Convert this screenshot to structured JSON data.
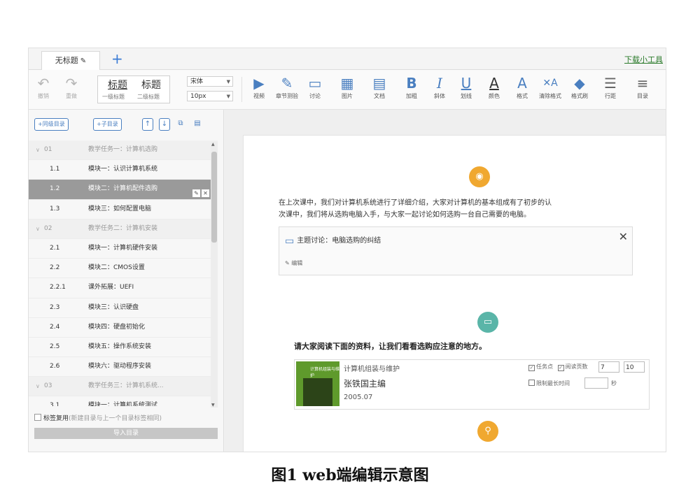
{
  "tabbar": {
    "doc_tab": "无标题",
    "doc_tab_icon": "pencil-icon",
    "add_tab": "+",
    "download_link": "下载小工具"
  },
  "toolbar": {
    "undo": "撤销",
    "redo": "重做",
    "style_title_1": "标题",
    "style_title_2": "标题",
    "style_sub_1": "一级标题",
    "style_sub_2": "二级标题",
    "font_family": "宋体",
    "font_size": "10px",
    "buttons": [
      {
        "label": "视频",
        "icon": "video-icon"
      },
      {
        "label": "章节测验",
        "icon": "quiz-icon"
      },
      {
        "label": "讨论",
        "icon": "discussion-icon"
      },
      {
        "label": "图片",
        "icon": "image-icon"
      },
      {
        "label": "文档",
        "icon": "document-icon"
      },
      {
        "label": "加粗",
        "icon": "bold-icon"
      },
      {
        "label": "斜体",
        "icon": "italic-icon"
      },
      {
        "label": "划线",
        "icon": "underline-icon"
      },
      {
        "label": "颜色",
        "icon": "font-color-icon"
      },
      {
        "label": "格式",
        "icon": "format-icon"
      },
      {
        "label": "清除格式",
        "icon": "clear-format-icon"
      },
      {
        "label": "格式刷",
        "icon": "format-brush-icon"
      },
      {
        "label": "行距",
        "icon": "line-height-icon"
      },
      {
        "label": "目录",
        "icon": "toc-icon"
      }
    ]
  },
  "sidebar": {
    "add_sibling": "+同级目录",
    "add_child": "+子目录",
    "outline": [
      {
        "num": "01",
        "title": "教学任务一：计算机选购",
        "type": "group"
      },
      {
        "num": "1.1",
        "title": "模块一：认识计算机系统",
        "type": "item"
      },
      {
        "num": "1.2",
        "title": "模块二：计算机配件选购",
        "type": "selected"
      },
      {
        "num": "1.3",
        "title": "模块三：如何配置电脑",
        "type": "item"
      },
      {
        "num": "02",
        "title": "教学任务二：计算机安装",
        "type": "group"
      },
      {
        "num": "2.1",
        "title": "模块一：计算机硬件安装",
        "type": "item"
      },
      {
        "num": "2.2",
        "title": "模块二：CMOS设置",
        "type": "item"
      },
      {
        "num": "2.2.1",
        "title": "课外拓展：UEFI",
        "type": "item"
      },
      {
        "num": "2.3",
        "title": "模块三：认识硬盘",
        "type": "item"
      },
      {
        "num": "2.4",
        "title": "模块四：硬盘初始化",
        "type": "item"
      },
      {
        "num": "2.5",
        "title": "模块五：操作系统安装",
        "type": "item"
      },
      {
        "num": "2.6",
        "title": "模块六：驱动程序安装",
        "type": "item"
      },
      {
        "num": "03",
        "title": "教学任务三：计算机系统...",
        "type": "group"
      },
      {
        "num": "3.1",
        "title": "模块一：计算机系统测试",
        "type": "item"
      }
    ],
    "reuse_label": "标签复用",
    "reuse_hint": "(新建目录与上一个目录标签相同)",
    "import_button": "导入目录"
  },
  "editor": {
    "intro_line_1": "在上次课中，我们对计算机系统进行了详细介绍，大家对计算机的基本组成有了初步的认",
    "intro_line_2": "次课中，我们将从选购电脑入手，与大家一起讨论如何选购一台自己需要的电脑。",
    "topic_title": "主题讨论：电脑选购的纠结",
    "topic_edit": "编辑",
    "reading_prompt": "请大家阅读下面的资料，让我们看看选购应注意的地方。",
    "book": {
      "title": "计算机组装与维护",
      "author": "张铁国主编",
      "date": "2005.07",
      "cover_text": "计算机组装与维护",
      "opt_task": "任务点",
      "opt_pages": "阅读页数",
      "page_from": "7",
      "page_to": "10",
      "opt_time": "限制最长时间",
      "time_unit": "秒"
    }
  },
  "caption": "图1  web端编辑示意图",
  "colors": {
    "accent": "#4a7fc0",
    "badge_orange": "#f0a830",
    "badge_teal": "#5ab5a8",
    "selected_row": "#9a9a9a"
  }
}
